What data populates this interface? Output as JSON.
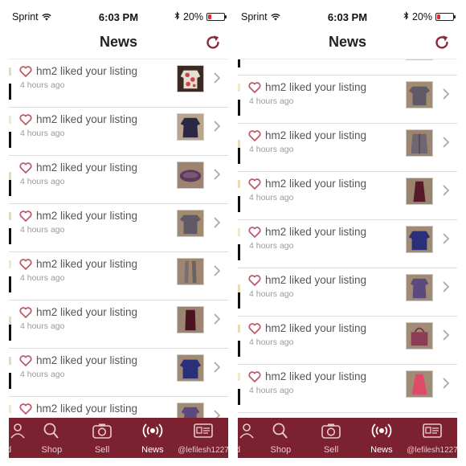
{
  "status": {
    "carrier": "Sprint",
    "time": "6:03 PM",
    "battery": "20%",
    "battery_level": 0.2
  },
  "navbar": {
    "title": "News"
  },
  "colors": {
    "brand": "#7b2130",
    "heart": "#c0596a",
    "battery_low": "#e0302e"
  },
  "notification": {
    "text": "hm2 liked your listing",
    "time": "4 hours ago",
    "partial_time": "4 hours ago"
  },
  "left_items": [
    {
      "thumb": "red-white-print-top"
    },
    {
      "thumb": "navy-blouse"
    },
    {
      "thumb": "purple-bag"
    },
    {
      "thumb": "grey-tee"
    },
    {
      "thumb": "grey-scarf"
    },
    {
      "thumb": "maroon-top"
    },
    {
      "thumb": "blue-top"
    },
    {
      "thumb": "purple-top"
    }
  ],
  "right_items": [
    {
      "thumb": "partial-item"
    },
    {
      "thumb": "grey-tee"
    },
    {
      "thumb": "grey-cardigan"
    },
    {
      "thumb": "burgundy-tank"
    },
    {
      "thumb": "blue-top"
    },
    {
      "thumb": "purple-top"
    },
    {
      "thumb": "pink-bag"
    },
    {
      "thumb": "pink-dress"
    }
  ],
  "tabbar": {
    "left": [
      {
        "id": "me",
        "label": "d",
        "icon": "person-icon"
      },
      {
        "id": "shop",
        "label": "Shop",
        "icon": "search-icon"
      },
      {
        "id": "sell",
        "label": "Sell",
        "icon": "camera-icon"
      },
      {
        "id": "news",
        "label": "News",
        "icon": "broadcast-icon",
        "active": true
      },
      {
        "id": "profile",
        "label": "@lefilesh1227",
        "icon": "id-card-icon"
      }
    ],
    "right": [
      {
        "id": "me",
        "label": "d",
        "icon": "person-icon"
      },
      {
        "id": "shop",
        "label": "Shop",
        "icon": "search-icon"
      },
      {
        "id": "sell",
        "label": "Sell",
        "icon": "camera-icon"
      },
      {
        "id": "news",
        "label": "News",
        "icon": "broadcast-icon",
        "active": true
      },
      {
        "id": "profile",
        "label": "@lefilesh1227",
        "icon": "id-card-icon"
      }
    ]
  }
}
